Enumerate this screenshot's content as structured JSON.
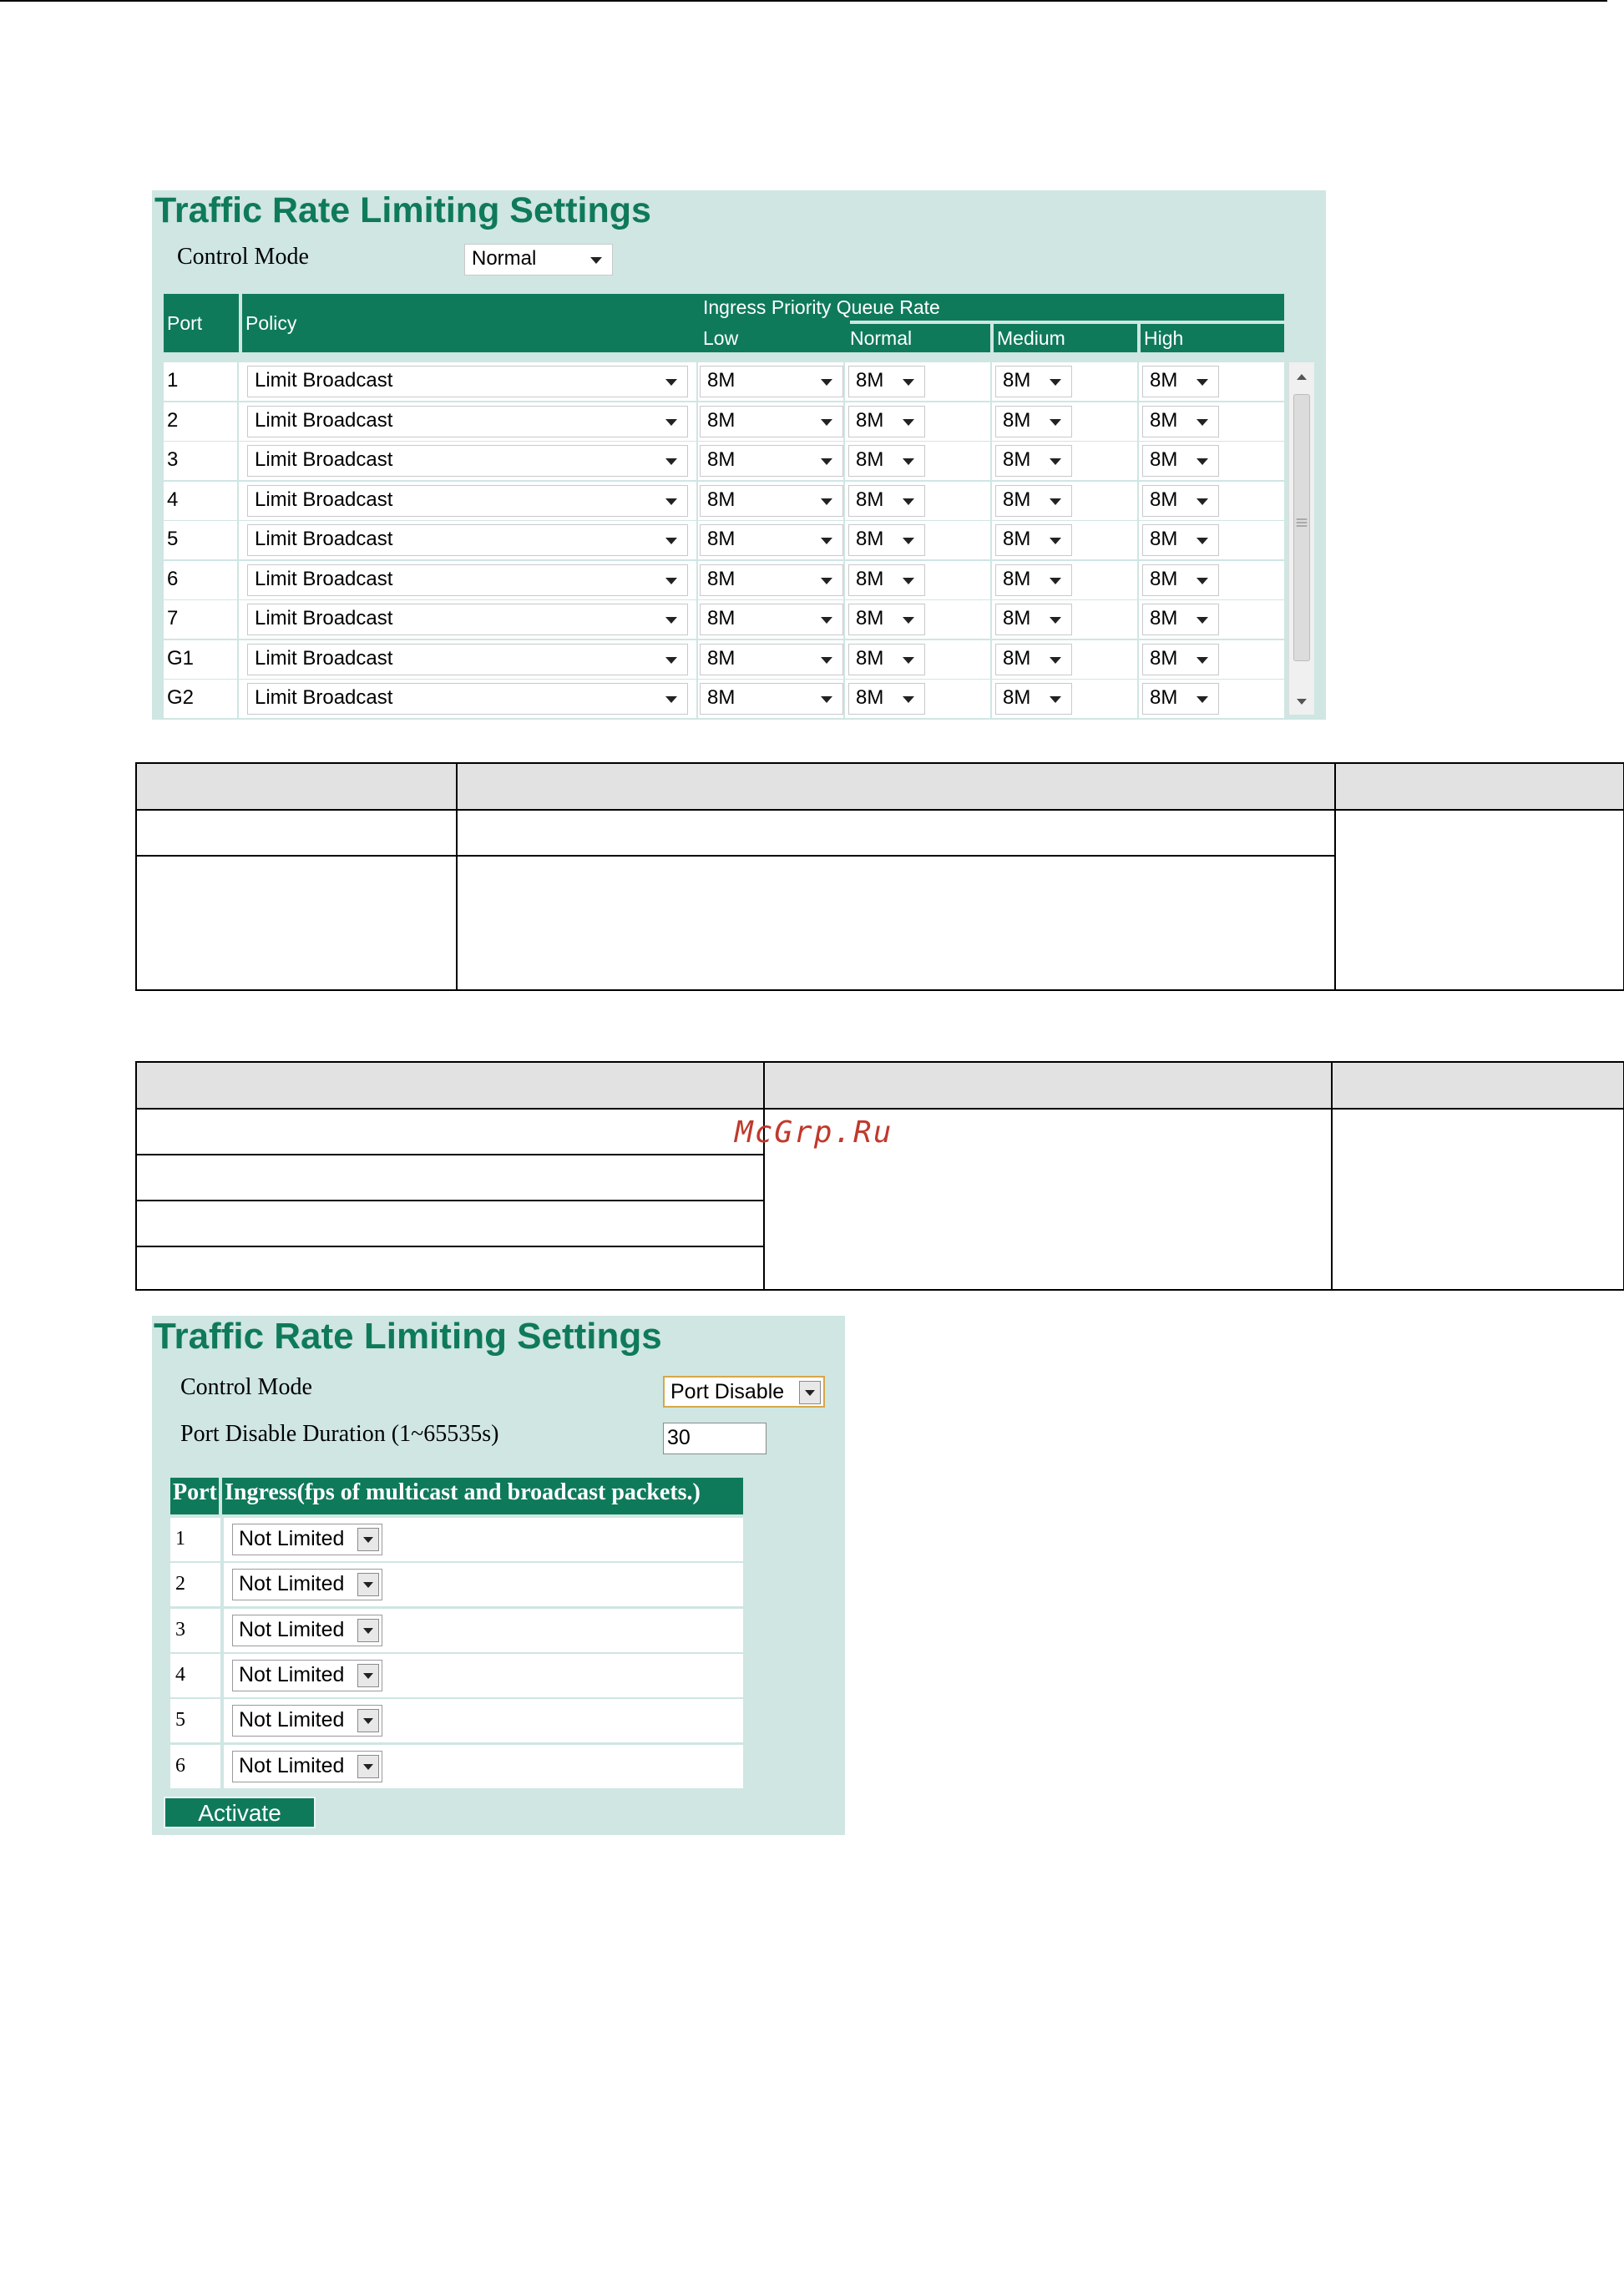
{
  "watermark": "McGrp.Ru",
  "panel1": {
    "title": "Traffic Rate Limiting Settings",
    "control_mode_label": "Control Mode",
    "control_mode_value": "Normal",
    "headers": {
      "port": "Port",
      "policy": "Policy",
      "ingress": "Ingress Priority Queue Rate",
      "low": "Low",
      "normal": "Normal",
      "medium": "Medium",
      "high": "High"
    },
    "rows": [
      {
        "port": "1",
        "policy": "Limit Broadcast",
        "low": "8M",
        "normal": "8M",
        "medium": "8M",
        "high": "8M"
      },
      {
        "port": "2",
        "policy": "Limit Broadcast",
        "low": "8M",
        "normal": "8M",
        "medium": "8M",
        "high": "8M"
      },
      {
        "port": "3",
        "policy": "Limit Broadcast",
        "low": "8M",
        "normal": "8M",
        "medium": "8M",
        "high": "8M"
      },
      {
        "port": "4",
        "policy": "Limit Broadcast",
        "low": "8M",
        "normal": "8M",
        "medium": "8M",
        "high": "8M"
      },
      {
        "port": "5",
        "policy": "Limit Broadcast",
        "low": "8M",
        "normal": "8M",
        "medium": "8M",
        "high": "8M"
      },
      {
        "port": "6",
        "policy": "Limit Broadcast",
        "low": "8M",
        "normal": "8M",
        "medium": "8M",
        "high": "8M"
      },
      {
        "port": "7",
        "policy": "Limit Broadcast",
        "low": "8M",
        "normal": "8M",
        "medium": "8M",
        "high": "8M"
      },
      {
        "port": "G1",
        "policy": "Limit Broadcast",
        "low": "8M",
        "normal": "8M",
        "medium": "8M",
        "high": "8M"
      },
      {
        "port": "G2",
        "policy": "Limit Broadcast",
        "low": "8M",
        "normal": "8M",
        "medium": "8M",
        "high": "8M"
      }
    ]
  },
  "panel2": {
    "title": "Traffic Rate Limiting Settings",
    "control_mode_label": "Control Mode",
    "control_mode_value": "Port Disable",
    "duration_label": "Port Disable Duration (1~65535s)",
    "duration_value": "30",
    "headers": {
      "port": "Port",
      "ingress": "Ingress(fps of multicast and broadcast packets.)"
    },
    "rows": [
      {
        "port": "1",
        "value": "Not Limited"
      },
      {
        "port": "2",
        "value": "Not Limited"
      },
      {
        "port": "3",
        "value": "Not Limited"
      },
      {
        "port": "4",
        "value": "Not Limited"
      },
      {
        "port": "5",
        "value": "Not Limited"
      },
      {
        "port": "6",
        "value": "Not Limited"
      }
    ],
    "activate_label": "Activate"
  }
}
